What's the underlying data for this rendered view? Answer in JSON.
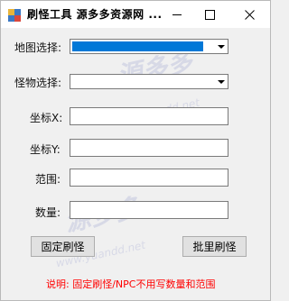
{
  "window": {
    "title": "刷怪工具 源多多资源网 ...",
    "icon": "app-icon",
    "controls": [
      "minimize-icon",
      "maximize-icon",
      "close-icon"
    ]
  },
  "form": {
    "map_label": "地图选择:",
    "monster_label": "怪物选择:",
    "x_label": "坐标X:",
    "y_label": "坐标Y:",
    "range_label": "范围:",
    "count_label": "数量:",
    "map_value": "",
    "monster_value": "",
    "x_value": "",
    "y_value": "",
    "range_value": "",
    "count_value": ""
  },
  "buttons": {
    "fixed_spawn": "固定刷怪",
    "batch_spawn": "批里刷怪"
  },
  "note": "说明: 固定刷怪/NPC不用写数量和范围",
  "watermark": {
    "text": "源多多",
    "url": "www.yuandd.net"
  },
  "colors": {
    "selection": "#0078d7",
    "note": "#ff0000",
    "background": "#f0f0f0"
  }
}
